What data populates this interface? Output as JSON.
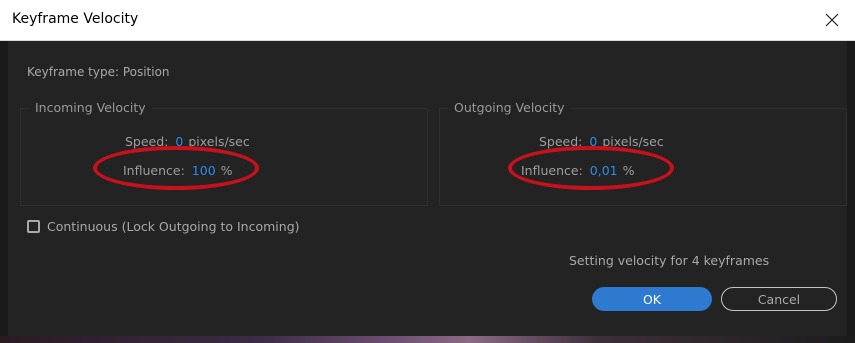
{
  "window": {
    "title": "Keyframe Velocity",
    "close_icon": "close-icon"
  },
  "dialog": {
    "keyframe_type": "Keyframe type: Position",
    "incoming": {
      "title": "Incoming Velocity",
      "speed_label": "Speed:",
      "speed_value": "0",
      "speed_unit": "pixels/sec",
      "influence_label": "Influence:",
      "influence_value": "100",
      "influence_unit": "%"
    },
    "outgoing": {
      "title": "Outgoing Velocity",
      "speed_label": "Speed:",
      "speed_value": "0",
      "speed_unit": "pixels/sec",
      "influence_label": "Influence:",
      "influence_value": "0,01",
      "influence_unit": "%"
    },
    "continuous_label": "Continuous (Lock Outgoing to Incoming)",
    "continuous_checked": false,
    "status_text": "Setting velocity for 4 keyframes",
    "ok_label": "OK",
    "cancel_label": "Cancel"
  },
  "colors": {
    "value_accent": "#2d8ceb",
    "ok_button": "#2e7ad1",
    "annotation_oval": "#c8121b",
    "dialog_bg": "#232323"
  }
}
